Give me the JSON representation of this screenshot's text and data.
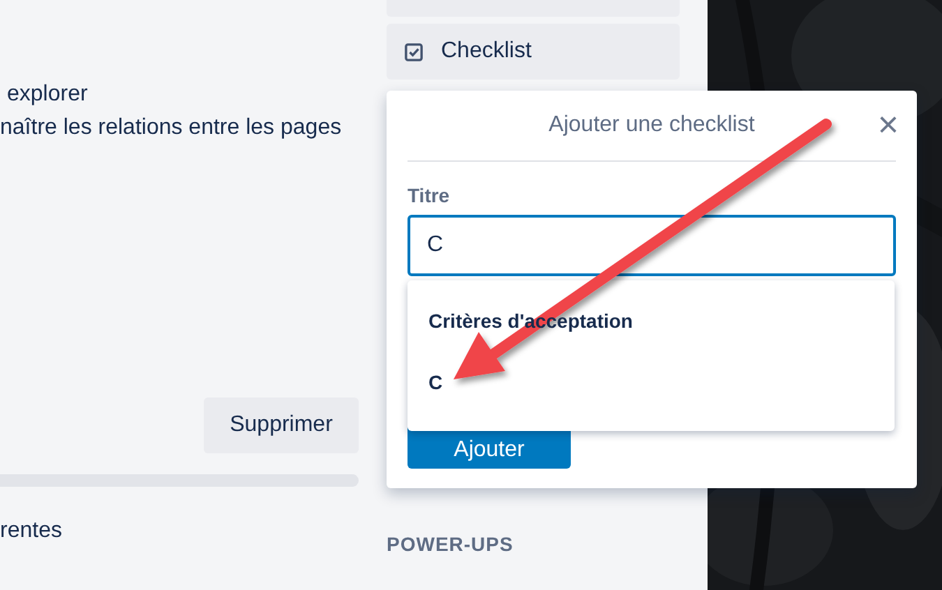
{
  "main": {
    "lines": [
      "explorer",
      "naître les relations entre les pages"
    ],
    "delete_button": "Supprimer",
    "footer_text": "rentes"
  },
  "sidebar": {
    "checklist_button": "Checklist",
    "section_title": "POWER-UPS"
  },
  "popup": {
    "title": "Ajouter une checklist",
    "close": "×",
    "field_label": "Titre",
    "field_value": "C",
    "suggestions": [
      {
        "label": "Critères d'acceptation"
      },
      {
        "label": "C"
      }
    ],
    "submit": "Ajouter"
  }
}
